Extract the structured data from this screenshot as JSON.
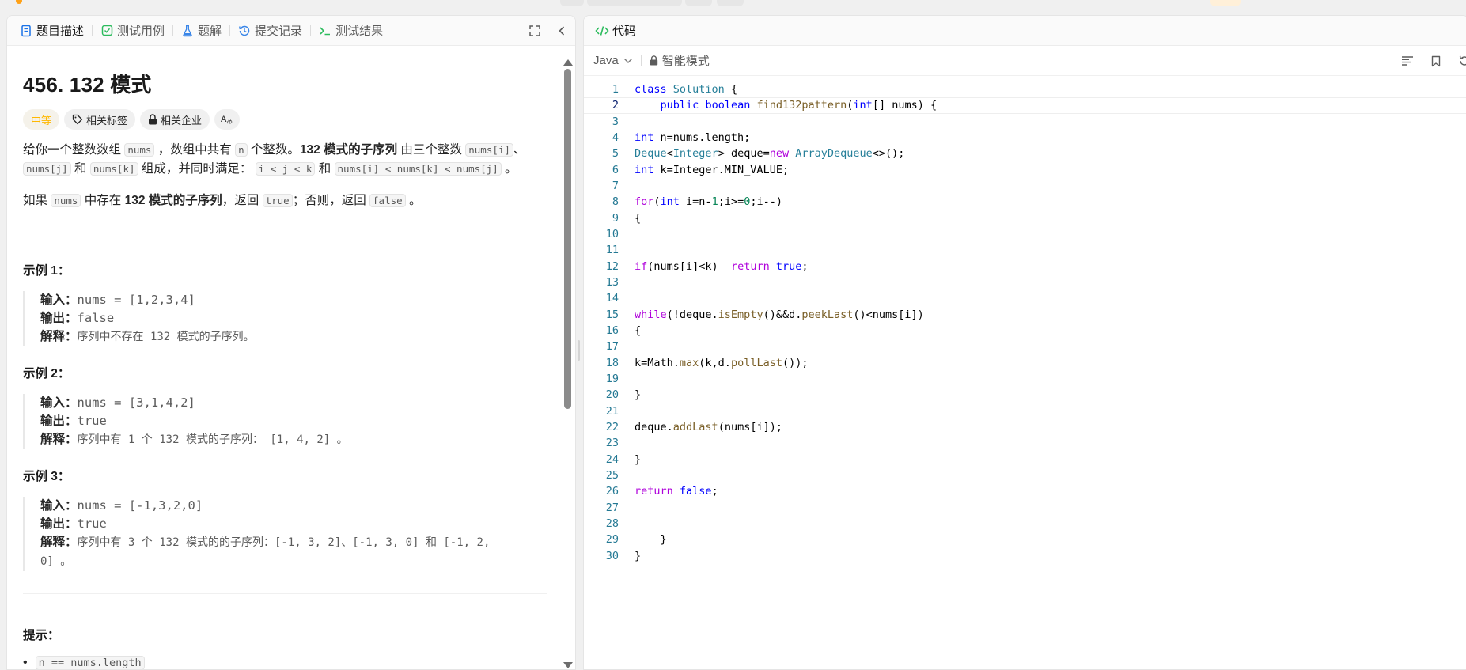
{
  "left_tabs": [
    {
      "label": "题目描述",
      "icon": "description-icon",
      "active": true
    },
    {
      "label": "测试用例",
      "icon": "checkbox-icon",
      "active": false
    },
    {
      "label": "题解",
      "icon": "flask-icon",
      "active": false
    },
    {
      "label": "提交记录",
      "icon": "history-icon",
      "active": false
    },
    {
      "label": "测试结果",
      "icon": "terminal-icon",
      "active": false
    }
  ],
  "problem": {
    "title": "456. 132 模式",
    "tags": {
      "difficulty": "中等",
      "topics": "相关标签",
      "companies": "相关企业",
      "translate": "Aあ"
    },
    "para1": {
      "t1": "给你一个整数数组",
      "c1": "nums",
      "t2": "，数组中共有",
      "c2": "n",
      "t3": "个整数。",
      "b1": "132 模式的子序列",
      "t4": "由三个整数",
      "c3": "nums[i]",
      "t5": "、",
      "c4": "nums[j]",
      "t6": "和",
      "c5": "nums[k]",
      "t7": "组成，并同时满足：",
      "c6": "i < j < k",
      "t8": "和",
      "c7": "nums[i] < nums[k] < nums[j]",
      "t9": "。"
    },
    "para2": {
      "t1": "如果",
      "c1": "nums",
      "t2": "中存在",
      "b1": "132 模式的子序列",
      "t3": "，返回",
      "c2": "true",
      "t4": "；否则，返回",
      "c3": "false",
      "t5": "。"
    },
    "examples": [
      {
        "title": "示例 1：",
        "input_label": "输入：",
        "input": "nums = [1,2,3,4]",
        "output_label": "输出：",
        "output": "false",
        "explain_label": "解释：",
        "explain": "序列中不存在 132 模式的子序列。",
        "explain2": ""
      },
      {
        "title": "示例 2：",
        "input_label": "输入：",
        "input": "nums = [3,1,4,2]",
        "output_label": "输出：",
        "output": "true",
        "explain_label": "解释：",
        "explain": "序列中有 1 个 132 模式的子序列： [1, 4, 2] 。",
        "explain2": ""
      },
      {
        "title": "示例 3：",
        "input_label": "输入：",
        "input": "nums = [-1,3,2,0]",
        "output_label": "输出：",
        "output": "true",
        "explain_label": "解释：",
        "explain": "序列中有 3 个 132 模式的的子序列：[-1, 3, 2]、[-1, 3, 0] 和 [-1, 2,",
        "explain2": "0] 。"
      }
    ],
    "hint_title": "提示：",
    "hints": [
      "n == nums.length"
    ]
  },
  "code_panel": {
    "tab_label": "代码",
    "language": "Java",
    "mode": "智能模式",
    "lines": [
      {
        "n": "1"
      },
      {
        "n": "2"
      },
      {
        "n": "3"
      },
      {
        "n": "4"
      },
      {
        "n": "5"
      },
      {
        "n": "6"
      },
      {
        "n": "7"
      },
      {
        "n": "8"
      },
      {
        "n": "9"
      },
      {
        "n": "10"
      },
      {
        "n": "11"
      },
      {
        "n": "12"
      },
      {
        "n": "13"
      },
      {
        "n": "14"
      },
      {
        "n": "15"
      },
      {
        "n": "16"
      },
      {
        "n": "17"
      },
      {
        "n": "18"
      },
      {
        "n": "19"
      },
      {
        "n": "20"
      },
      {
        "n": "21"
      },
      {
        "n": "22"
      },
      {
        "n": "23"
      },
      {
        "n": "24"
      },
      {
        "n": "25"
      },
      {
        "n": "26"
      },
      {
        "n": "27"
      },
      {
        "n": "28"
      },
      {
        "n": "29"
      },
      {
        "n": "30"
      }
    ],
    "code": {
      "l1": [
        "class",
        "Solution",
        "{"
      ],
      "l2": [
        "public",
        "boolean",
        "find132pattern",
        "(",
        "int",
        "[] nums) {"
      ],
      "l4": [
        "int",
        " n=nums.length;"
      ],
      "l5": [
        "Deque",
        "<",
        "Integer",
        "> deque=",
        "new",
        "ArrayDequeue",
        "<>();"
      ],
      "l6": [
        "int",
        " k=Integer.MIN_VALUE;"
      ],
      "l8": [
        "for",
        "(",
        "int",
        " i=n-",
        "1",
        ";i>=",
        "0",
        ";i--)"
      ],
      "l9": "{",
      "l12": [
        "if",
        "(nums[i]<k)  ",
        "return",
        "true",
        ";"
      ],
      "l15": [
        "while",
        "(!deque.",
        "isEmpty",
        "()&&d.",
        "peekLast",
        "()<nums[i])"
      ],
      "l16": "{",
      "l18": [
        "k=Math.",
        "max",
        "(k,d.",
        "pollLast",
        "());"
      ],
      "l20": "}",
      "l22": [
        "deque.",
        "addLast",
        "(nums[i]);"
      ],
      "l24": "}",
      "l26": [
        "return",
        "false",
        ";"
      ],
      "l29": "}",
      "l30": "}"
    }
  },
  "colors": {
    "accent": "#ffa116",
    "difficulty_medium": "#ffb800",
    "keyword": "#0000ff",
    "control": "#af00db",
    "type": "#267f99",
    "function": "#795e26",
    "number": "#098658",
    "line_number": "#237893"
  }
}
